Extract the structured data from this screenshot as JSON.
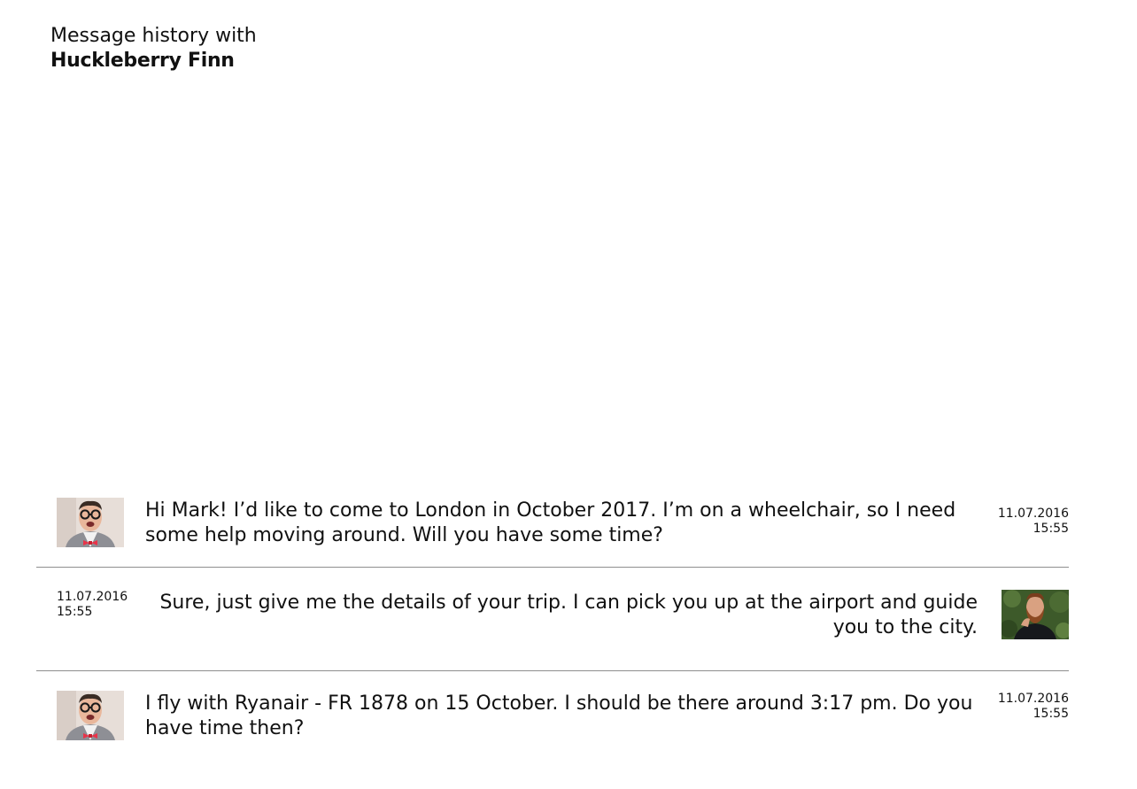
{
  "header": {
    "line1": "Message history with",
    "contact_name": "Huckleberry Finn"
  },
  "messages": [
    {
      "direction": "incoming",
      "avatar": "avatar-glasses-bowtie",
      "text": "Hi Mark! I’d like to come to London in October 2017. I’m on a wheelchair, so I need some help moving around. Will you have some time?",
      "date": "11.07.2016",
      "time": "15:55"
    },
    {
      "direction": "outgoing",
      "avatar": "avatar-bearded-man",
      "text": "Sure, just give me the details of your trip. I can pick you up at the airport and guide you to the city.",
      "date": "11.07.2016",
      "time": "15:55"
    },
    {
      "direction": "incoming",
      "avatar": "avatar-glasses-bowtie",
      "text": "I fly with Ryanair - FR 1878 on 15 October. I should be there around 3:17 pm. Do you have time then?",
      "date": "11.07.2016",
      "time": "15:55"
    }
  ]
}
